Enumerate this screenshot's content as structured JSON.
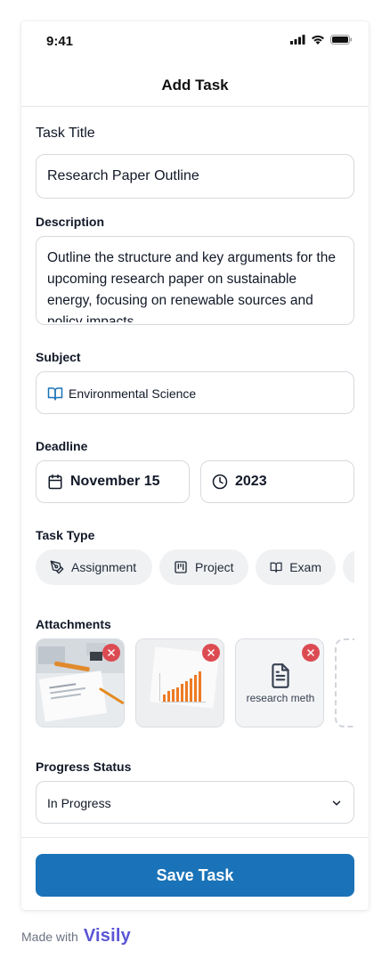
{
  "status_bar": {
    "time": "9:41"
  },
  "header": {
    "title": "Add Task"
  },
  "form": {
    "title_label": "Task Title",
    "title_value": "Research Paper Outline",
    "description_label": "Description",
    "description_value": "Outline the structure and key arguments for the upcoming research paper on sustainable energy, focusing on renewable sources and policy impacts.",
    "subject_label": "Subject",
    "subject_value": "Environmental Science",
    "deadline_label": "Deadline",
    "deadline_date": "November 15",
    "deadline_year": "2023",
    "task_type_label": "Task Type",
    "task_types": [
      {
        "label": "Assignment",
        "icon": "pen-tool-icon"
      },
      {
        "label": "Project",
        "icon": "kanban-icon"
      },
      {
        "label": "Exam",
        "icon": "book-open-icon"
      }
    ],
    "attachments_label": "Attachments",
    "attachments": [
      {
        "kind": "image",
        "subject": "desk with papers and pen"
      },
      {
        "kind": "image",
        "subject": "orange bar chart"
      },
      {
        "kind": "file",
        "name": "research meth",
        "icon": "file-text-icon"
      }
    ],
    "progress_label": "Progress Status",
    "progress_value": "In Progress"
  },
  "actions": {
    "save_label": "Save Task"
  },
  "footer": {
    "made_with": "Made with",
    "brand": "Visily"
  },
  "colors": {
    "primary": "#1a73b8",
    "remove": "#dc4b52",
    "brand": "#5b55d6",
    "chip_bg": "#f0f1f3"
  }
}
